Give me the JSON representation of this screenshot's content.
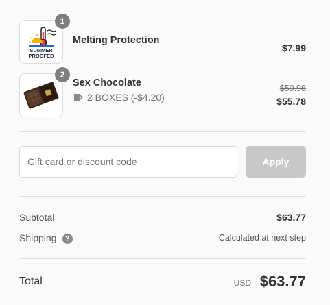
{
  "items": [
    {
      "quantity": "1",
      "name": "Melting Protection",
      "price": "$7.99",
      "image_text": [
        "SUMMER",
        "PROOFED"
      ],
      "image_icon": "thermometer-sun-icon"
    },
    {
      "quantity": "2",
      "name": "Sex Chocolate",
      "variant": "2 BOXES (-$4.20)",
      "variant_icon": "tag-icon",
      "original_price": "$59.98",
      "price": "$55.78",
      "image_icon": "chocolate-box-image"
    }
  ],
  "discount": {
    "placeholder": "Gift card or discount code",
    "apply_label": "Apply"
  },
  "summary": {
    "subtotal_label": "Subtotal",
    "subtotal_value": "$63.77",
    "shipping_label": "Shipping",
    "shipping_help_icon": "question-icon",
    "shipping_value": "Calculated at next step",
    "total_label": "Total",
    "currency": "USD",
    "total_value": "$63.77"
  },
  "colors": {
    "badge": "#7f7f7f",
    "apply_disabled": "#c8c8c8",
    "divider": "#e1e1e1"
  }
}
